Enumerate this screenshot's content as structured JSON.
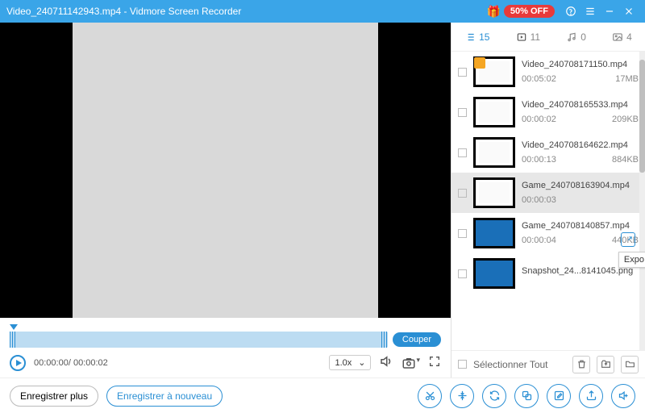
{
  "titlebar": {
    "file": "Video_240711142943.mp4",
    "sep": "  -  ",
    "app": "Vidmore Screen Recorder",
    "promo": "50% OFF"
  },
  "tabs": {
    "list_count": "15",
    "video_count": "11",
    "audio_count": "0",
    "image_count": "4"
  },
  "items": [
    {
      "name": "Video_240708171150.mp4",
      "dur": "00:05:02",
      "size": "17MB",
      "thumb": "doc",
      "crown": true
    },
    {
      "name": "Video_240708165533.mp4",
      "dur": "00:00:02",
      "size": "209KB",
      "thumb": "doc"
    },
    {
      "name": "Video_240708164622.mp4",
      "dur": "00:00:13",
      "size": "884KB",
      "thumb": "doc"
    },
    {
      "name": "Game_240708163904.mp4",
      "dur": "00:00:03",
      "size": "",
      "thumb": "doc",
      "sel": true
    },
    {
      "name": "Game_240708140857.mp4",
      "dur": "00:00:04",
      "size": "440KB",
      "thumb": "blue"
    },
    {
      "name": "Snapshot_24...8141045.png",
      "dur": "",
      "size": "",
      "thumb": "blue"
    }
  ],
  "export_tooltip": "Expo",
  "player": {
    "cut": "Couper",
    "time_current": "00:00:00",
    "time_sep": "/ ",
    "time_total": "00:00:02",
    "speed": "1.0x"
  },
  "select_all": "Sélectionner Tout",
  "bottom": {
    "record_more": "Enregistrer plus",
    "record_again": "Enregistrer à nouveau"
  }
}
